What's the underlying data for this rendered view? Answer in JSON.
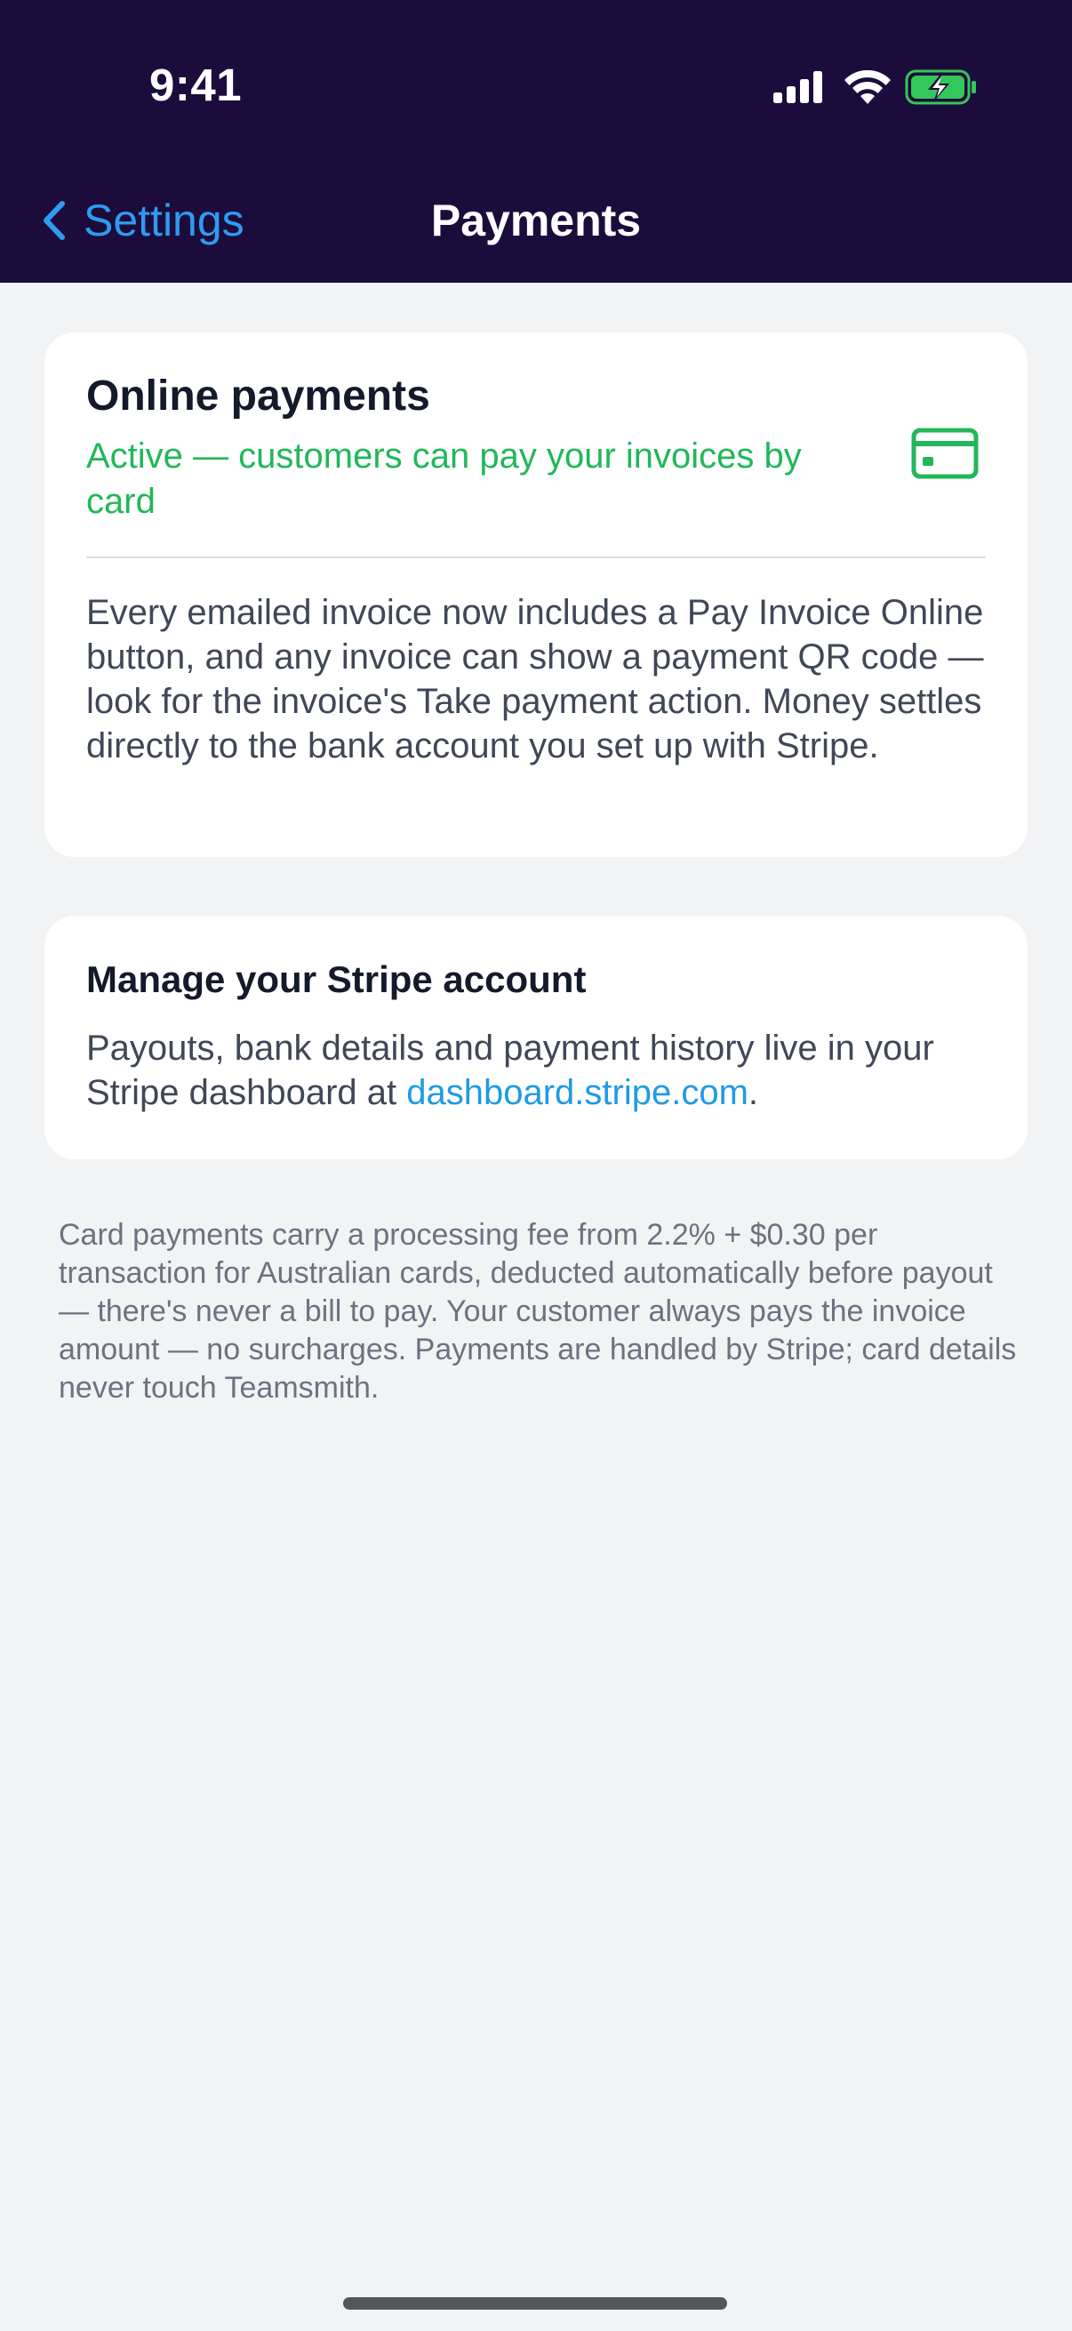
{
  "status_bar": {
    "time": "9:41"
  },
  "nav": {
    "back_label": "Settings",
    "title": "Payments"
  },
  "online_payments": {
    "title": "Online payments",
    "status": "Active — customers can pay your invoices by card",
    "icon": "credit-card-icon",
    "description": "Every emailed invoice now includes a Pay Invoice Online button, and any invoice can show a payment QR code — look for the invoice's Take payment action. Money settles directly to the bank account you set up with Stripe."
  },
  "stripe_account": {
    "title": "Manage your Stripe account",
    "text_before_link": "Payouts, bank details and payment history live in your Stripe dashboard at ",
    "link_text": "dashboard.stripe.com",
    "text_after_link": "."
  },
  "footnote": "Card payments carry a processing fee from 2.2% + $0.30 per transaction for Australian cards, deducted automatically before payout — there's never a bill to pay. Your customer always pays the invoice amount — no surcharges. Payments are handled by Stripe; card details never touch Teamsmith.",
  "colors": {
    "header_bg": "#1c0c3c",
    "accent_blue": "#2f9bef",
    "active_green": "#21b75a",
    "page_bg": "#f2f3f5"
  }
}
